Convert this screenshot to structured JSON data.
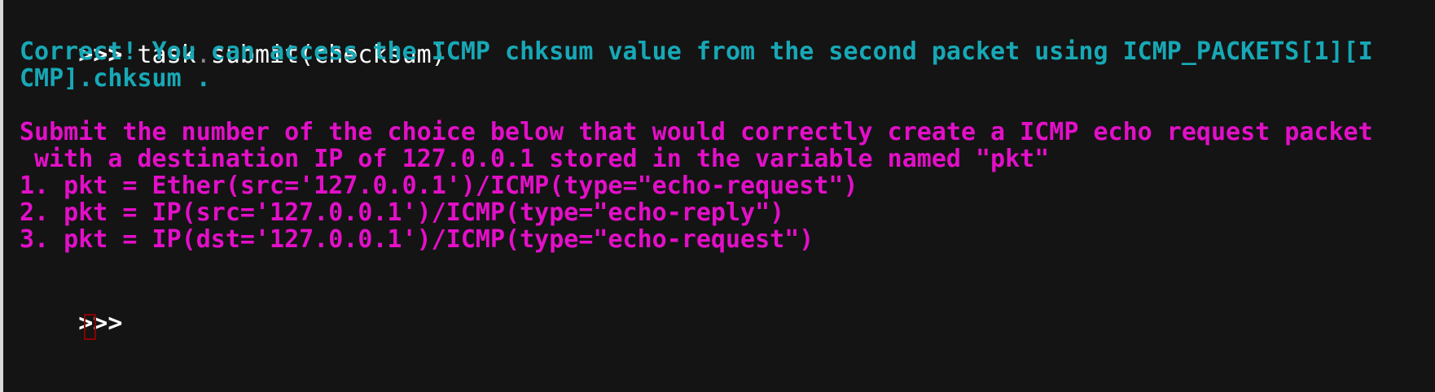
{
  "terminal": {
    "prompt": ">>>",
    "command": {
      "before_dot": "task",
      "dot": ".",
      "after_dot": "submit(checksum)"
    },
    "response_lines": [
      "Correct! You can access the ICMP chksum value from the second packet using ICMP_PACKETS[1][I",
      "CMP].chksum ."
    ],
    "question_lines": [
      "Submit the number of the choice below that would correctly create a ICMP echo request packet",
      " with a destination IP of 127.0.0.1 stored in the variable named \"pkt\""
    ],
    "choices": [
      "1. pkt = Ether(src='127.0.0.1')/ICMP(type=\"echo-request\")",
      "2. pkt = IP(src='127.0.0.1')/ICMP(type=\"echo-reply\")",
      "3. pkt = IP(dst='127.0.0.1')/ICMP(type=\"echo-request\")"
    ],
    "input_prompt": ">>>"
  },
  "colors": {
    "background": "#141414",
    "response": "#17a8b6",
    "question": "#e30fc8",
    "cursor": "#8b0000"
  }
}
